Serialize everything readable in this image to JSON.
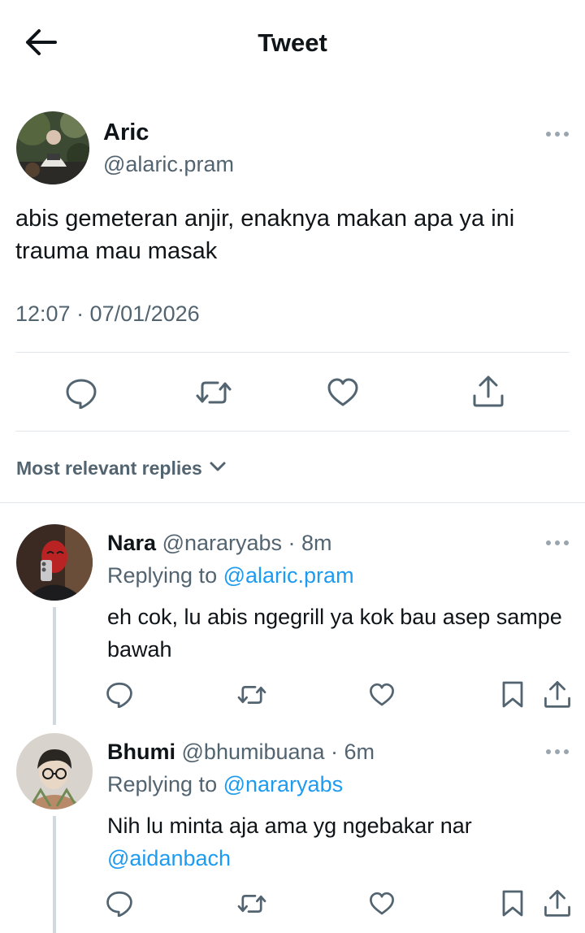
{
  "header": {
    "title": "Tweet",
    "back_icon": "arrow-left-icon"
  },
  "tweet": {
    "author_name": "Aric",
    "author_handle": "@alaric.pram",
    "text": "abis gemeteran anjir, enaknya makan apa ya ini trauma mau masak",
    "timestamp": "12:07 · 07/01/2026",
    "actions": [
      "reply-icon",
      "retweet-icon",
      "like-icon",
      "share-icon"
    ]
  },
  "sort": {
    "label": "Most relevant replies",
    "icon": "chevron-down-icon"
  },
  "replies": [
    {
      "name": "Nara",
      "meta": "@nararyabs · 8m",
      "replying_prefix": "Replying to",
      "replying_to": "@alaric.pram",
      "text": "eh cok, lu abis ngegrill ya kok bau asep sampe bawah",
      "mention": ""
    },
    {
      "name": "Bhumi",
      "meta": "@bhumibuana · 6m",
      "replying_prefix": "Replying to",
      "replying_to": "@nararyabs",
      "text": "Nih lu minta aja ama yg ngebakar nar",
      "mention": "@aidanbach"
    }
  ],
  "colors": {
    "text": "#0f1419",
    "secondary": "#536471",
    "link": "#1d9bf0",
    "divider": "#e1e6ea",
    "icon": "#536471"
  }
}
